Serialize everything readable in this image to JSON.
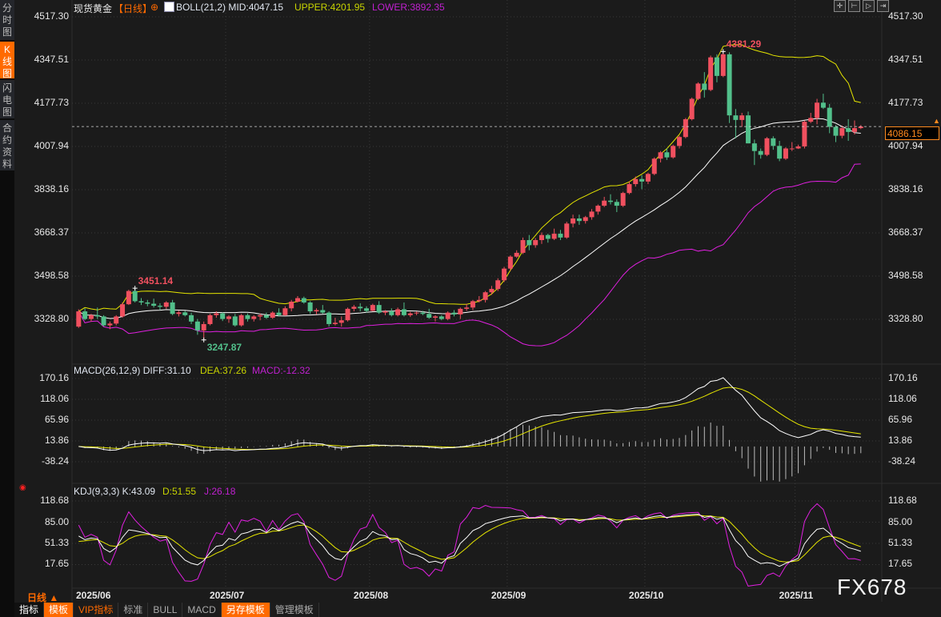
{
  "sidebar": {
    "items": [
      {
        "label": [
          "分",
          "时",
          "图"
        ],
        "active": false
      },
      {
        "label": [
          "K",
          "线",
          "图"
        ],
        "active": true
      },
      {
        "label": [
          "闪",
          "电",
          "图"
        ],
        "active": false
      },
      {
        "label": [
          "合",
          "约",
          "资",
          "料"
        ],
        "active": false
      }
    ]
  },
  "header": {
    "symbol": "现货黄金",
    "period": "【日线】",
    "boll": "BOLL(21,2) MID:4047.15",
    "upper": "UPPER:4201.95",
    "lower": "LOWER:3892.35"
  },
  "macd_header": {
    "name": "MACD(26,12,9) DIFF:31.10",
    "dea": "DEA:37.26",
    "macd": "MACD:-12.32"
  },
  "kdj_header": {
    "name": "KDJ(9,3,3) K:43.09",
    "d": "D:51.55",
    "j": "J:26.18"
  },
  "current_price": "4086.15",
  "period_selector": "日线 ▲",
  "watermark": "FX678",
  "toolbar_icons": [
    "crosshair-icon",
    "zoom-in-icon",
    "zoom-out-icon",
    "scroll-end-icon"
  ],
  "tabs": [
    {
      "label": "指标",
      "style": "white"
    },
    {
      "label": "模板",
      "style": "orange"
    },
    {
      "label": "VIP指标",
      "style": "vip"
    },
    {
      "label": "标准",
      "style": "plain"
    },
    {
      "label": "BULL",
      "style": "plain"
    },
    {
      "label": "MACD",
      "style": "plain"
    },
    {
      "label": "另存模板",
      "style": "orange"
    },
    {
      "label": "管理模板",
      "style": "plain"
    }
  ],
  "colors": {
    "up": "#f0505f",
    "down": "#52c08b",
    "mid": "#ffffff",
    "upper": "#e6e600",
    "lower": "#e020e0",
    "accent": "#ff6a00",
    "background": "#1b1b1b"
  },
  "chart_data": {
    "type": "candlestick",
    "title": "现货黄金",
    "indicators": {
      "boll": [
        21,
        2
      ],
      "macd": [
        26,
        12,
        9
      ],
      "kdj": [
        9,
        3,
        3
      ]
    },
    "price_ticks": [
      "4517.30",
      "4347.51",
      "4177.73",
      "4007.94",
      "3838.16",
      "3668.37",
      "3498.58",
      "3328.80"
    ],
    "macd_ticks": [
      "170.16",
      "118.06",
      "65.96",
      "13.86",
      "-38.24"
    ],
    "kdj_ticks": [
      "118.68",
      "85.00",
      "51.33",
      "17.65"
    ],
    "ylim": [
      3328.8,
      4517.3
    ],
    "x_ticks": [
      {
        "label": "2025/06",
        "index": 0
      },
      {
        "label": "2025/07",
        "index": 24
      },
      {
        "label": "2025/08",
        "index": 47
      },
      {
        "label": "2025/09",
        "index": 69
      },
      {
        "label": "2025/10",
        "index": 91
      },
      {
        "label": "2025/11",
        "index": 115
      }
    ],
    "annotations": [
      {
        "text": "3451.14",
        "index": 9,
        "kind": "high"
      },
      {
        "text": "3247.87",
        "index": 20,
        "kind": "low"
      },
      {
        "text": "4381.29",
        "index": 103,
        "kind": "high"
      }
    ],
    "ohlc": [
      [
        3300,
        3368,
        3295,
        3360
      ],
      [
        3360,
        3372,
        3325,
        3330
      ],
      [
        3330,
        3350,
        3320,
        3345
      ],
      [
        3345,
        3375,
        3330,
        3340
      ],
      [
        3340,
        3345,
        3300,
        3305
      ],
      [
        3305,
        3320,
        3290,
        3312
      ],
      [
        3312,
        3345,
        3305,
        3340
      ],
      [
        3340,
        3395,
        3335,
        3388
      ],
      [
        3388,
        3445,
        3385,
        3440
      ],
      [
        3440,
        3451,
        3395,
        3400
      ],
      [
        3400,
        3412,
        3385,
        3395
      ],
      [
        3395,
        3405,
        3380,
        3390
      ],
      [
        3390,
        3410,
        3375,
        3382
      ],
      [
        3382,
        3392,
        3365,
        3378
      ],
      [
        3378,
        3400,
        3370,
        3395
      ],
      [
        3395,
        3405,
        3345,
        3350
      ],
      [
        3350,
        3362,
        3340,
        3356
      ],
      [
        3356,
        3362,
        3340,
        3345
      ],
      [
        3345,
        3355,
        3310,
        3320
      ],
      [
        3320,
        3330,
        3268,
        3285
      ],
      [
        3285,
        3320,
        3248,
        3310
      ],
      [
        3310,
        3350,
        3305,
        3345
      ],
      [
        3345,
        3360,
        3335,
        3352
      ],
      [
        3352,
        3356,
        3322,
        3330
      ],
      [
        3330,
        3345,
        3315,
        3340
      ],
      [
        3340,
        3350,
        3300,
        3305
      ],
      [
        3305,
        3350,
        3300,
        3345
      ],
      [
        3345,
        3352,
        3320,
        3330
      ],
      [
        3330,
        3345,
        3320,
        3340
      ],
      [
        3340,
        3352,
        3325,
        3345
      ],
      [
        3345,
        3355,
        3330,
        3335
      ],
      [
        3335,
        3360,
        3330,
        3355
      ],
      [
        3355,
        3372,
        3340,
        3345
      ],
      [
        3345,
        3380,
        3342,
        3372
      ],
      [
        3372,
        3405,
        3360,
        3398
      ],
      [
        3398,
        3420,
        3395,
        3412
      ],
      [
        3412,
        3418,
        3390,
        3395
      ],
      [
        3395,
        3400,
        3350,
        3360
      ],
      [
        3360,
        3372,
        3348,
        3365
      ],
      [
        3365,
        3385,
        3350,
        3355
      ],
      [
        3355,
        3360,
        3300,
        3310
      ],
      [
        3310,
        3335,
        3305,
        3315
      ],
      [
        3315,
        3340,
        3300,
        3325
      ],
      [
        3325,
        3375,
        3320,
        3370
      ],
      [
        3370,
        3385,
        3360,
        3378
      ],
      [
        3378,
        3392,
        3360,
        3372
      ],
      [
        3372,
        3380,
        3355,
        3362
      ],
      [
        3362,
        3390,
        3360,
        3385
      ],
      [
        3385,
        3400,
        3350,
        3355
      ],
      [
        3355,
        3365,
        3345,
        3360
      ],
      [
        3360,
        3372,
        3340,
        3345
      ],
      [
        3345,
        3375,
        3340,
        3368
      ],
      [
        3368,
        3395,
        3340,
        3345
      ],
      [
        3345,
        3358,
        3338,
        3352
      ],
      [
        3352,
        3360,
        3345,
        3355
      ],
      [
        3355,
        3362,
        3345,
        3350
      ],
      [
        3350,
        3370,
        3330,
        3335
      ],
      [
        3335,
        3345,
        3320,
        3340
      ],
      [
        3340,
        3345,
        3325,
        3330
      ],
      [
        3330,
        3360,
        3325,
        3355
      ],
      [
        3355,
        3365,
        3340,
        3348
      ],
      [
        3348,
        3375,
        3330,
        3370
      ],
      [
        3370,
        3390,
        3362,
        3375
      ],
      [
        3375,
        3405,
        3365,
        3400
      ],
      [
        3400,
        3420,
        3395,
        3405
      ],
      [
        3405,
        3440,
        3395,
        3435
      ],
      [
        3435,
        3460,
        3425,
        3448
      ],
      [
        3448,
        3490,
        3440,
        3482
      ],
      [
        3482,
        3535,
        3475,
        3528
      ],
      [
        3528,
        3580,
        3520,
        3575
      ],
      [
        3575,
        3600,
        3570,
        3590
      ],
      [
        3590,
        3650,
        3585,
        3640
      ],
      [
        3640,
        3660,
        3600,
        3620
      ],
      [
        3620,
        3648,
        3610,
        3640
      ],
      [
        3640,
        3670,
        3625,
        3660
      ],
      [
        3660,
        3665,
        3630,
        3645
      ],
      [
        3645,
        3685,
        3640,
        3665
      ],
      [
        3665,
        3680,
        3640,
        3650
      ],
      [
        3650,
        3712,
        3645,
        3705
      ],
      [
        3705,
        3740,
        3690,
        3725
      ],
      [
        3725,
        3740,
        3700,
        3715
      ],
      [
        3715,
        3735,
        3705,
        3730
      ],
      [
        3730,
        3762,
        3720,
        3752
      ],
      [
        3752,
        3780,
        3740,
        3775
      ],
      [
        3775,
        3810,
        3770,
        3795
      ],
      [
        3795,
        3820,
        3780,
        3790
      ],
      [
        3790,
        3800,
        3750,
        3775
      ],
      [
        3775,
        3830,
        3770,
        3825
      ],
      [
        3825,
        3870,
        3820,
        3860
      ],
      [
        3860,
        3890,
        3850,
        3880
      ],
      [
        3880,
        3895,
        3840,
        3870
      ],
      [
        3870,
        3905,
        3860,
        3900
      ],
      [
        3900,
        3965,
        3895,
        3960
      ],
      [
        3960,
        3990,
        3945,
        3985
      ],
      [
        3985,
        4000,
        3955,
        3965
      ],
      [
        3965,
        4015,
        3960,
        4010
      ],
      [
        4010,
        4050,
        4000,
        4045
      ],
      [
        4045,
        4120,
        4040,
        4115
      ],
      [
        4115,
        4200,
        4110,
        4195
      ],
      [
        4195,
        4260,
        4190,
        4255
      ],
      [
        4255,
        4300,
        4200,
        4230
      ],
      [
        4230,
        4365,
        4225,
        4358
      ],
      [
        4358,
        4370,
        4260,
        4285
      ],
      [
        4285,
        4381,
        4280,
        4370
      ],
      [
        4370,
        4378,
        4100,
        4130
      ],
      [
        4130,
        4155,
        4040,
        4112
      ],
      [
        4112,
        4140,
        4085,
        4130
      ],
      [
        4130,
        4145,
        4020,
        4020
      ],
      [
        4020,
        4035,
        3935,
        3990
      ],
      [
        3990,
        4000,
        3960,
        3975
      ],
      [
        3975,
        4045,
        3970,
        4040
      ],
      [
        4040,
        4048,
        3995,
        4010
      ],
      [
        4010,
        4030,
        3950,
        3960
      ],
      [
        3960,
        4005,
        3955,
        4000
      ],
      [
        4000,
        4025,
        3990,
        4000
      ],
      [
        4000,
        4015,
        3998,
        4008
      ],
      [
        4008,
        4110,
        4000,
        4105
      ],
      [
        4105,
        4140,
        4100,
        4120
      ],
      [
        4120,
        4195,
        4095,
        4180
      ],
      [
        4180,
        4215,
        4155,
        4160
      ],
      [
        4160,
        4175,
        4060,
        4085
      ],
      [
        4085,
        4092,
        4025,
        4050
      ],
      [
        4050,
        4090,
        4040,
        4080
      ],
      [
        4080,
        4115,
        4030,
        4065
      ],
      [
        4065,
        4110,
        4055,
        4080
      ],
      [
        4080,
        4092,
        4076,
        4086
      ]
    ]
  }
}
